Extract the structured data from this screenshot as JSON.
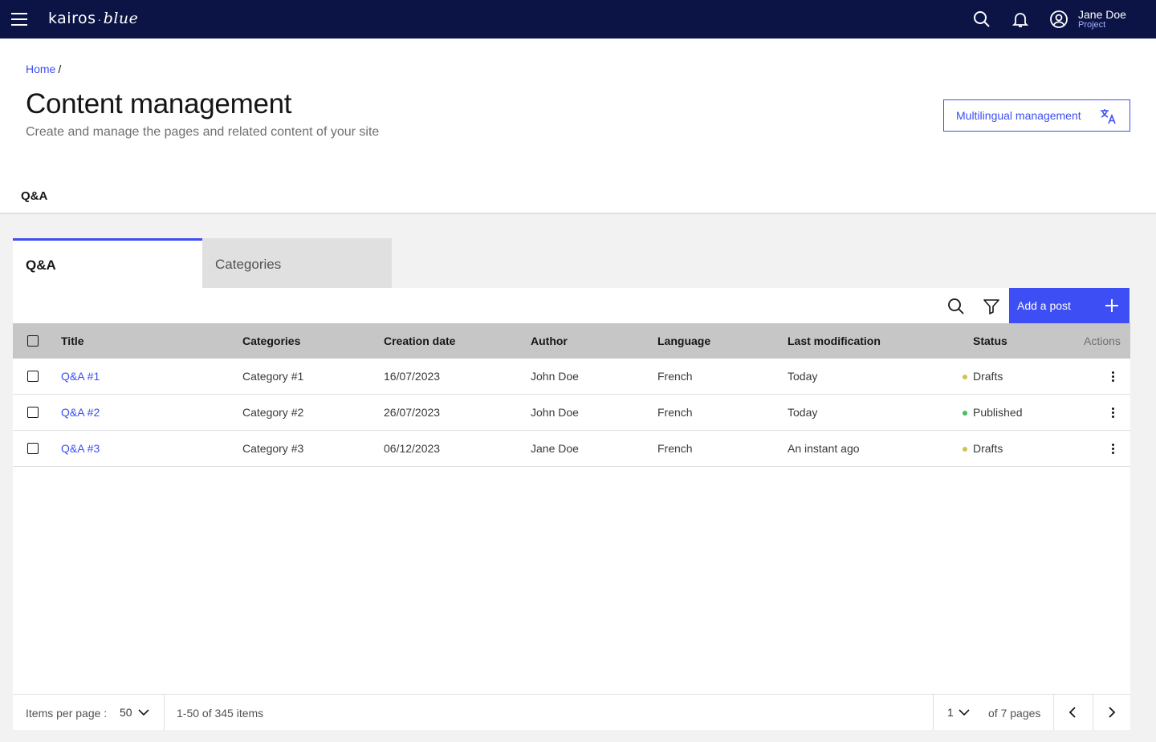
{
  "topbar": {
    "brand": "kairos",
    "brand_sep": "·",
    "brand_suffix": "blue",
    "user_name": "Jane Doe",
    "user_project": "Project",
    "icons": [
      "menu-icon",
      "search-icon",
      "bell-icon",
      "user-circle-icon"
    ]
  },
  "breadcrumb": {
    "home": "Home",
    "separator": "/"
  },
  "header": {
    "title": "Content management",
    "subtitle": "Create and manage the pages and related content of your site",
    "multilingual_button": "Multilingual management"
  },
  "main_tab": {
    "label": "Q&A"
  },
  "subtabs": [
    {
      "label": "Q&A",
      "active": true
    },
    {
      "label": "Categories",
      "active": false
    }
  ],
  "toolbar": {
    "add_label": "Add a post"
  },
  "table": {
    "columns": [
      "Title",
      "Categories",
      "Creation date",
      "Author",
      "Language",
      "Last modification",
      "Status",
      "Actions"
    ],
    "rows": [
      {
        "title": "Q&A #1",
        "category": "Category #1",
        "created": "16/07/2023",
        "author": "John Doe",
        "language": "French",
        "modified": "Today",
        "status": "Drafts",
        "status_color": "#d2c44b"
      },
      {
        "title": "Q&A #2",
        "category": "Category #2",
        "created": "26/07/2023",
        "author": "John Doe",
        "language": "French",
        "modified": "Today",
        "status": "Published",
        "status_color": "#42be65"
      },
      {
        "title": "Q&A #3",
        "category": "Category #3",
        "created": "06/12/2023",
        "author": "Jane Doe",
        "language": "French",
        "modified": "An instant ago",
        "status": "Drafts",
        "status_color": "#d2c44b"
      }
    ]
  },
  "pagination": {
    "items_per_page_label": "Items per page :",
    "items_per_page": "50",
    "range": "1-50 of 345 items",
    "current_page": "1",
    "total_pages": "of 7 pages"
  },
  "colors": {
    "accent": "#3d4ef5",
    "topbar": "#0c1446",
    "header_row": "#c6c6c6"
  }
}
